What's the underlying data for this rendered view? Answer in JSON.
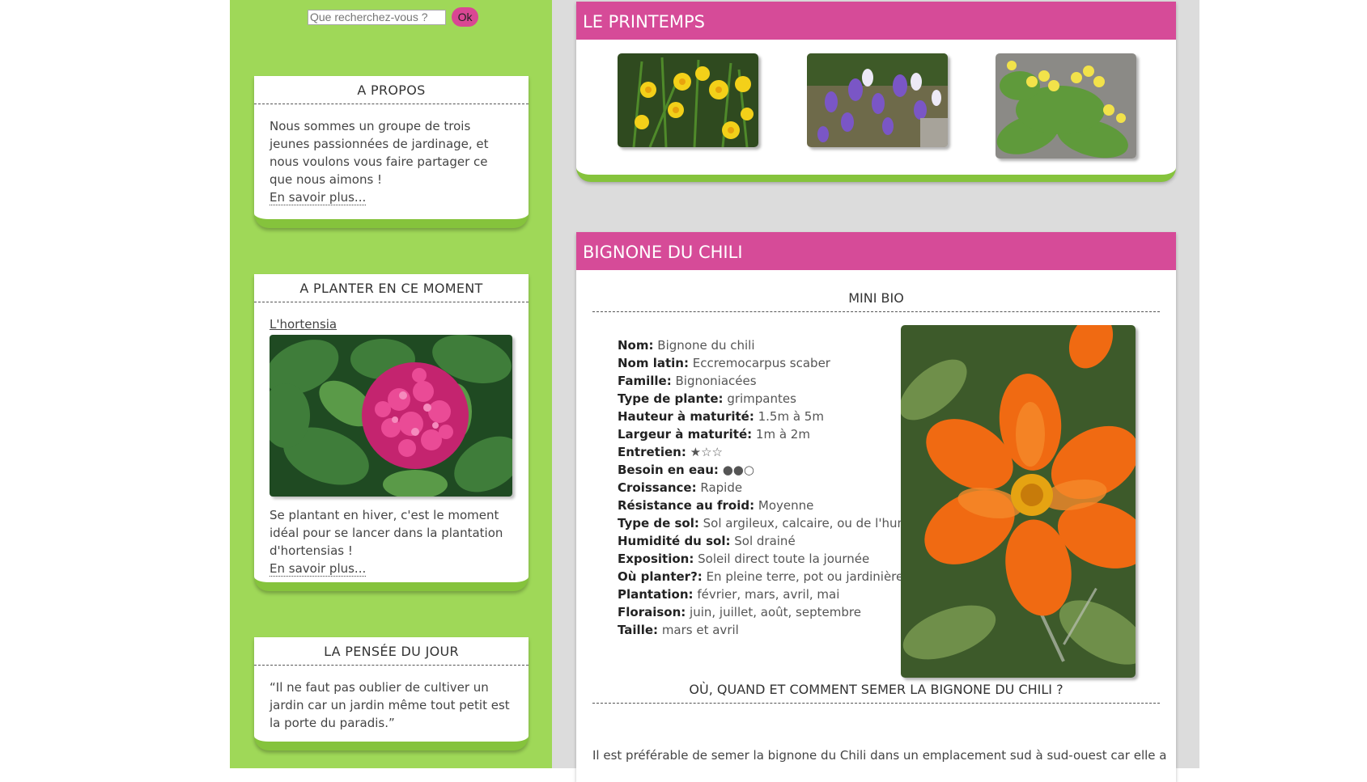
{
  "search": {
    "placeholder": "Que recherchez-vous ?",
    "button_label": "Ok"
  },
  "about": {
    "title": "A PROPOS",
    "text": "Nous sommes un groupe de trois jeunes passionnées de jardinage, et nous voulons vous faire partager ce que nous aimons !",
    "more": "En savoir plus..."
  },
  "plant_now": {
    "title": "A PLANTER EN CE MOMENT",
    "link": "L'hortensia",
    "text": "Se plantant en hiver, c'est le moment idéal pour se lancer dans la plantation d'hortensias !",
    "more": "En savoir plus..."
  },
  "thought": {
    "title": "LA PENSÉE DU JOUR",
    "text": "“Il ne faut pas oublier de cultiver un jardin car un jardin même tout petit est la porte du paradis.”"
  },
  "spring": {
    "title": "LE PRINTEMPS"
  },
  "plant": {
    "title": "BIGNONE DU CHILI",
    "mini_bio": "MINI BIO",
    "rows": [
      {
        "label": "Nom:",
        "value": "Bignone du chili"
      },
      {
        "label": "Nom latin:",
        "value": "Eccremocarpus scaber"
      },
      {
        "label": "Famille:",
        "value": "Bignoniacées"
      },
      {
        "label": "Type de plante:",
        "value": "grimpantes"
      },
      {
        "label": "Hauteur à maturité:",
        "value": "1.5m à 5m"
      },
      {
        "label": "Largeur à maturité:",
        "value": "1m à 2m"
      },
      {
        "label": "Entretien:",
        "value": "★☆☆"
      },
      {
        "label": "Besoin en eau:",
        "value": "●●○"
      },
      {
        "label": "Croissance:",
        "value": "Rapide"
      },
      {
        "label": "Résistance au froid:",
        "value": "Moyenne"
      },
      {
        "label": "Type de sol:",
        "value": "Sol argileux, calcaire, ou de l'humus"
      },
      {
        "label": "Humidité du sol:",
        "value": "Sol drainé"
      },
      {
        "label": "Exposition:",
        "value": "Soleil direct toute la journée"
      },
      {
        "label": "Où planter?:",
        "value": "En pleine terre, pot ou jardinière"
      },
      {
        "label": "Plantation:",
        "value": "février, mars, avril, mai"
      },
      {
        "label": "Floraison:",
        "value": "juin, juillet, août, septembre"
      },
      {
        "label": "Taille:",
        "value": "mars et avril"
      }
    ],
    "section2": "OÙ, QUAND ET COMMENT SEMER LA BIGNONE DU CHILI ?",
    "para": "Il est préférable de semer la bignone du Chili dans un emplacement sud à sud-ouest car elle a"
  },
  "colors": {
    "sidebar": "#9fd858",
    "accent_pink": "#d64b98",
    "accent_green": "#85c33c"
  }
}
